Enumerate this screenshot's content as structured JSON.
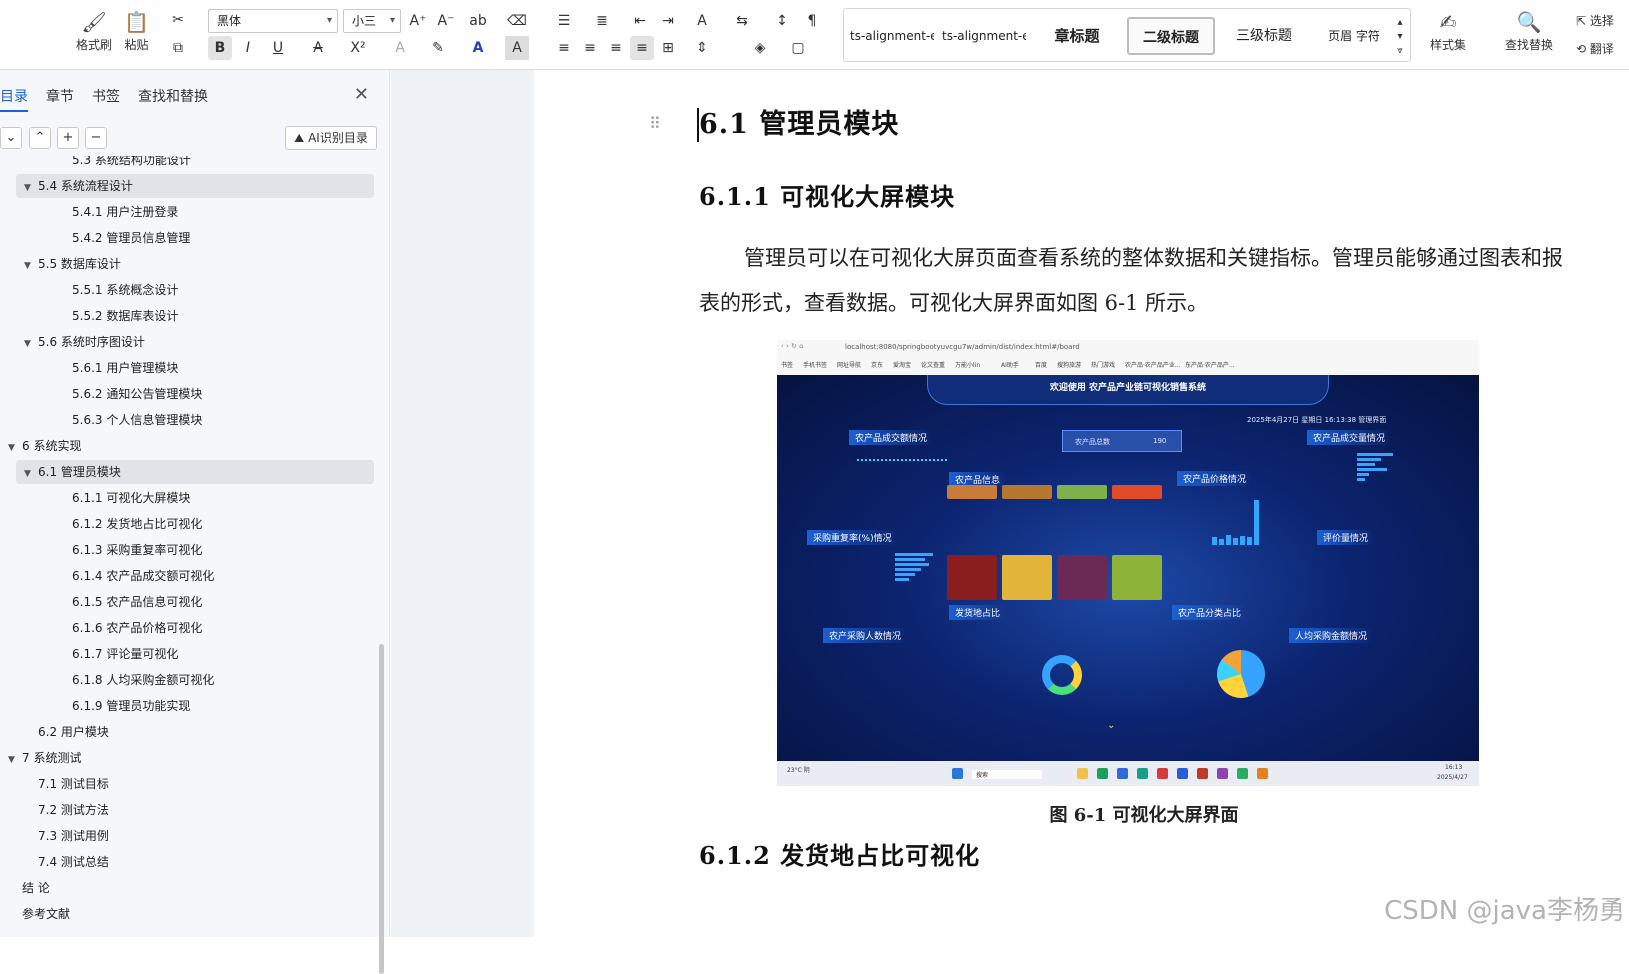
{
  "ribbon": {
    "format_painter": "格式刷",
    "paste": "粘贴",
    "font_name": "黑体",
    "font_size": "小三",
    "style_items": [
      "ts-alignment-e",
      "ts-alignment-e",
      "章标题",
      "二级标题",
      "三级标题",
      "页眉 字符"
    ],
    "style_set": "样式集",
    "find_replace": "查找替换",
    "select": "选择",
    "translate": "翻译"
  },
  "sidebar": {
    "tabs": [
      "目录",
      "章节",
      "书签",
      "查找和替换"
    ],
    "ai_button": "AI识别目录",
    "toc": [
      {
        "label": "5.3  系统结构功能设计",
        "indent": 2,
        "arrow": "",
        "hl": false
      },
      {
        "label": "5.4  系统流程设计",
        "indent": 1,
        "arrow": "▼",
        "hl": true
      },
      {
        "label": "5.4.1  用户注册登录",
        "indent": 2,
        "arrow": "",
        "hl": false
      },
      {
        "label": "5.4.2  管理员信息管理",
        "indent": 2,
        "arrow": "",
        "hl": false
      },
      {
        "label": "5.5  数据库设计",
        "indent": 1,
        "arrow": "▼",
        "hl": false
      },
      {
        "label": "5.5.1  系统概念设计",
        "indent": 2,
        "arrow": "",
        "hl": false
      },
      {
        "label": "5.5.2  数据库表设计",
        "indent": 2,
        "arrow": "",
        "hl": false
      },
      {
        "label": "5.6  系统时序图设计",
        "indent": 1,
        "arrow": "▼",
        "hl": false
      },
      {
        "label": "5.6.1  用户管理模块",
        "indent": 2,
        "arrow": "",
        "hl": false
      },
      {
        "label": "5.6.2  通知公告管理模块",
        "indent": 2,
        "arrow": "",
        "hl": false
      },
      {
        "label": "5.6.3  个人信息管理模块",
        "indent": 2,
        "arrow": "",
        "hl": false
      },
      {
        "label": "6  系统实现",
        "indent": 0,
        "arrow": "▼",
        "hl": false
      },
      {
        "label": "6.1  管理员模块",
        "indent": 1,
        "arrow": "▼",
        "hl": true
      },
      {
        "label": "6.1.1  可视化大屏模块",
        "indent": 2,
        "arrow": "",
        "hl": false
      },
      {
        "label": "6.1.2  发货地占比可视化",
        "indent": 2,
        "arrow": "",
        "hl": false
      },
      {
        "label": "6.1.3  采购重复率可视化",
        "indent": 2,
        "arrow": "",
        "hl": false
      },
      {
        "label": "6.1.4  农产品成交额可视化",
        "indent": 2,
        "arrow": "",
        "hl": false
      },
      {
        "label": "6.1.5  农产品信息可视化",
        "indent": 2,
        "arrow": "",
        "hl": false
      },
      {
        "label": "6.1.6  农产品价格可视化",
        "indent": 2,
        "arrow": "",
        "hl": false
      },
      {
        "label": "6.1.7  评论量可视化",
        "indent": 2,
        "arrow": "",
        "hl": false
      },
      {
        "label": "6.1.8  人均采购金额可视化",
        "indent": 2,
        "arrow": "",
        "hl": false
      },
      {
        "label": "6.1.9 管理员功能实现",
        "indent": 2,
        "arrow": "",
        "hl": false
      },
      {
        "label": "6.2 用户模块",
        "indent": 1,
        "arrow": "",
        "hl": false
      },
      {
        "label": "7  系统测试",
        "indent": 0,
        "arrow": "▼",
        "hl": false
      },
      {
        "label": "7.1  测试目标",
        "indent": 1,
        "arrow": "",
        "hl": false
      },
      {
        "label": "7.2  测试方法",
        "indent": 1,
        "arrow": "",
        "hl": false
      },
      {
        "label": "7.3  测试用例",
        "indent": 1,
        "arrow": "",
        "hl": false
      },
      {
        "label": "7.4  测试总结",
        "indent": 1,
        "arrow": "",
        "hl": false
      },
      {
        "label": "结  论",
        "indent": 0,
        "arrow": "",
        "hl": false
      },
      {
        "label": "参考文献",
        "indent": 0,
        "arrow": "",
        "hl": false
      }
    ]
  },
  "doc": {
    "h2": "6.1  管理员模块",
    "h3a": "6.1.1  可视化大屏模块",
    "para": "管理员可以在可视化大屏页面查看系统的整体数据和关键指标。管理员能够通过图表和报表的形式，查看数据。可视化大屏界面如图 6-1 所示。",
    "caption": "图 6-1  可视化大屏界面",
    "h3b": "6.1.2  发货地占比可视化"
  },
  "screenshot": {
    "url": "localhost:8080/springbootyuvcgu7w/admin/dist/index.html#/board",
    "bookmarks": [
      "书签",
      "手机书签",
      "网址导航",
      "京东",
      "爱淘宝",
      "论文查重",
      "万能小lin",
      "AI助手",
      "百度",
      "搜狗旅游",
      "热门游戏",
      "农产品·农产品产业...",
      "东产品·农产品产..."
    ],
    "title": "欢迎使用 农产品产业链可视化销售系统",
    "datetime": "2025年4月27日 星期日 16:13:38  管理界面",
    "total_label": "农产品总数",
    "total_value": "190",
    "panels": [
      "农产品成交额情况",
      "农产品成交量情况",
      "农产品信息",
      "农产品价格情况",
      "采购重复率(%)情况",
      "评价量情况",
      "发货地占比",
      "农产品分类占比",
      "农产采购人数情况",
      "人均采购金额情况"
    ],
    "weather": "23°C 阴",
    "search": "搜索",
    "clock": "16:13",
    "date": "2025/4/27"
  },
  "watermark": "CSDN @java李杨勇"
}
